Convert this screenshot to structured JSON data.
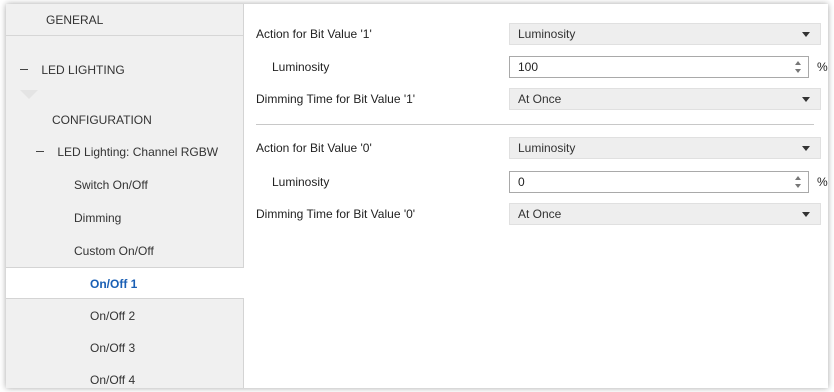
{
  "sidebar": {
    "items": [
      {
        "label": "GENERAL"
      },
      {
        "label": "LED LIGHTING"
      },
      {
        "label": "CONFIGURATION"
      },
      {
        "label": "LED Lighting: Channel RGBW"
      },
      {
        "label": "Switch On/Off"
      },
      {
        "label": "Dimming"
      },
      {
        "label": "Custom On/Off"
      },
      {
        "label": "On/Off 1"
      },
      {
        "label": "On/Off 2"
      },
      {
        "label": "On/Off 3"
      },
      {
        "label": "On/Off 4"
      }
    ]
  },
  "main": {
    "bit1": {
      "action_label": "Action for Bit Value '1'",
      "action_value": "Luminosity",
      "luminosity_label": "Luminosity",
      "luminosity_value": "100",
      "luminosity_unit": "%",
      "dimming_label": "Dimming Time for Bit Value '1'",
      "dimming_value": "At Once"
    },
    "bit0": {
      "action_label": "Action for Bit Value '0'",
      "action_value": "Luminosity",
      "luminosity_label": "Luminosity",
      "luminosity_value": "0",
      "luminosity_unit": "%",
      "dimming_label": "Dimming Time for Bit Value '0'",
      "dimming_value": "At Once"
    }
  },
  "colors": {
    "selected_text": "#1a5fb4",
    "sidebar_bg": "#f0f0f0",
    "field_bg": "#eeeeee"
  }
}
